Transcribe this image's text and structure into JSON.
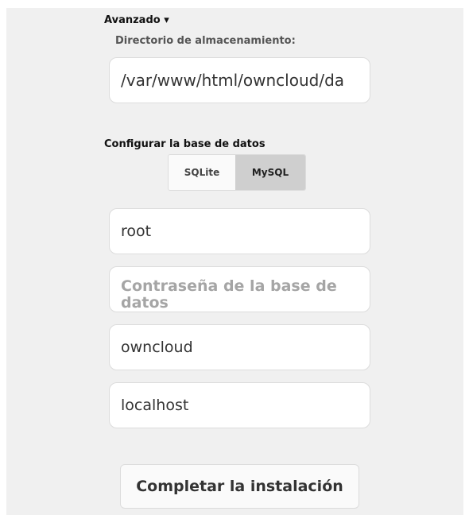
{
  "advanced": {
    "toggle_label": "Avanzado ▾"
  },
  "storage": {
    "label": "Directorio de almacenamiento:",
    "value": "/var/www/html/owncloud/da"
  },
  "database": {
    "heading": "Configurar la base de datos",
    "options": [
      "SQLite",
      "MySQL"
    ],
    "selected": "MySQL",
    "user_value": "root",
    "password_placeholder": "Contraseña de la base de datos",
    "name_value": "owncloud",
    "host_value": "localhost"
  },
  "install": {
    "button_label": "Completar la instalación"
  }
}
